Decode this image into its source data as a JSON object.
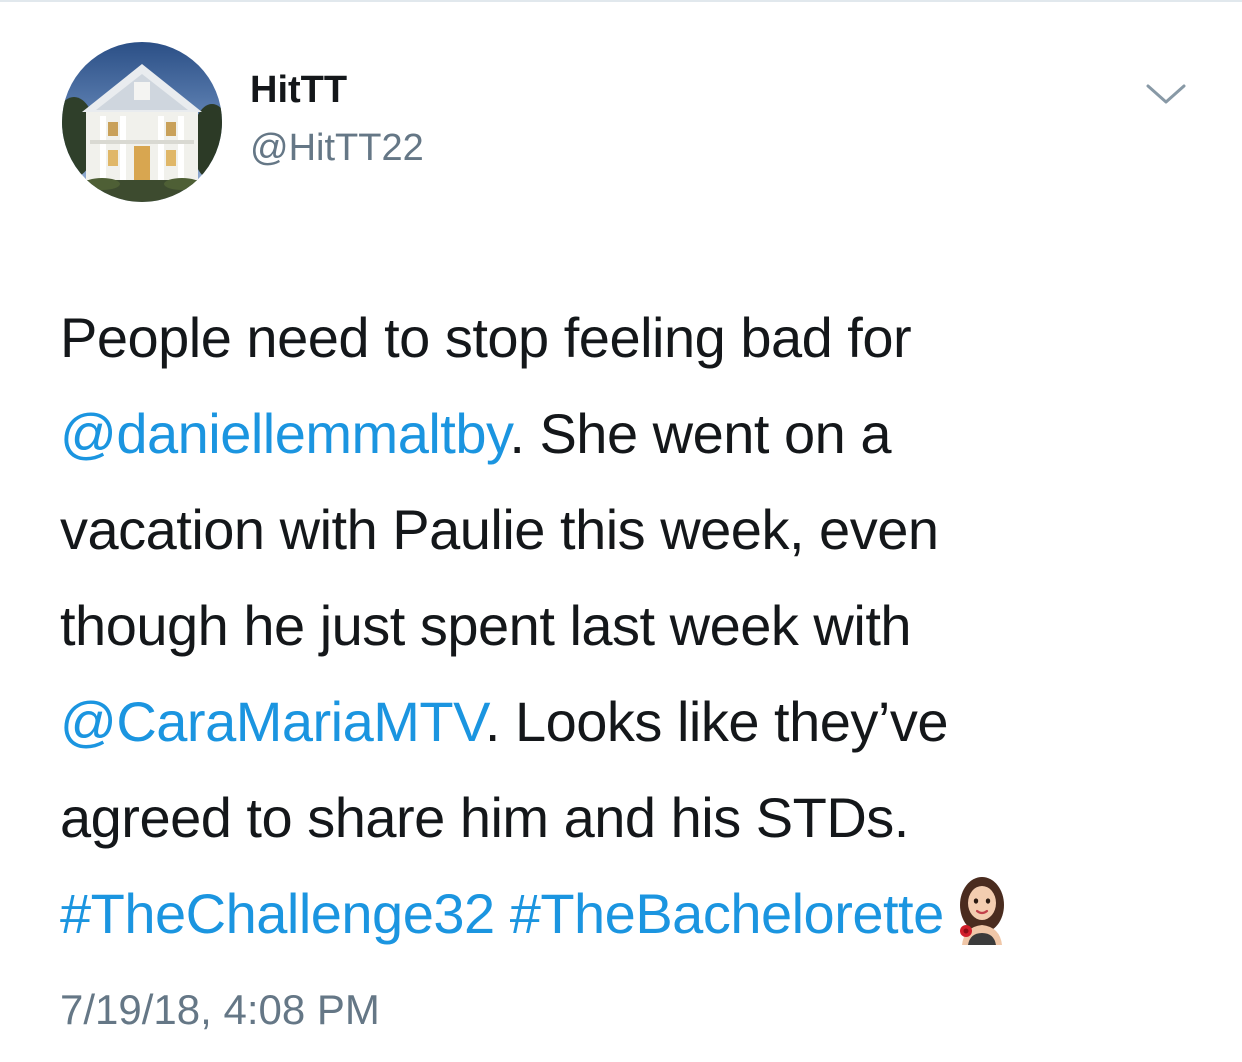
{
  "tweet": {
    "author": {
      "display_name": "HitTT",
      "handle": "@HitTT22",
      "avatar_icon": "mansion-avatar-photo"
    },
    "menu_icon": "chevron-down-icon",
    "text": {
      "line1": "People need to stop feeling bad for",
      "mention1": "@daniellemmaltby",
      "line2_rest": ". She went on a",
      "line3": "vacation with Paulie this week, even",
      "line4": "though he just spent last week with",
      "mention2": "@CaraMariaMTV",
      "line5_rest": ". Looks like they’ve",
      "line6": "agreed to share him and his STDs.",
      "hashtag1": "#TheChallenge32",
      "hashtag2": "#TheBachelorette",
      "emoji_icon": "bachelorette-hashflag-icon"
    },
    "timestamp": "7/19/18, 4:08 PM"
  },
  "colors": {
    "text": "#14171a",
    "secondary": "#657786",
    "link": "#1b95e0",
    "divider": "#e1e8ed"
  }
}
